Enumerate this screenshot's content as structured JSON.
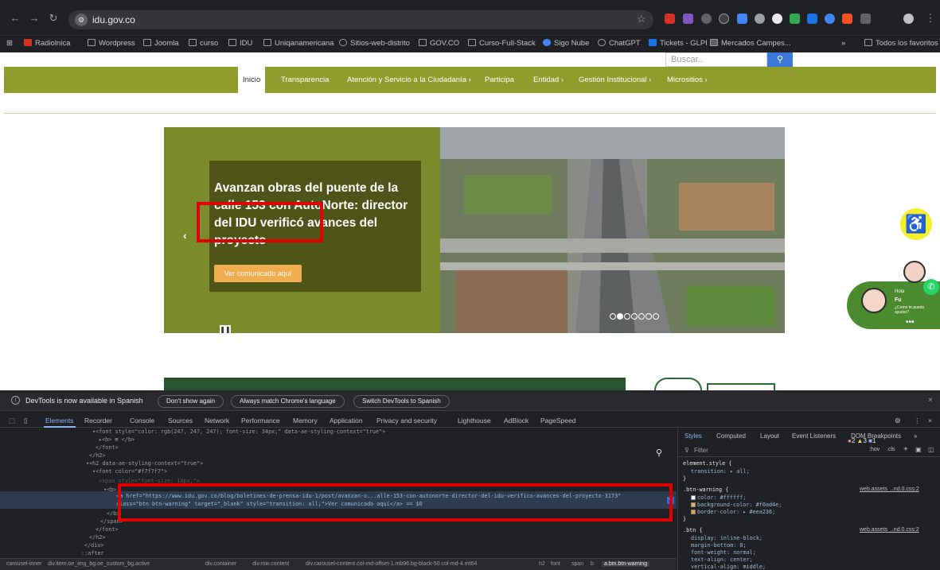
{
  "browser": {
    "url": "idu.gov.co",
    "bookmarks": [
      "Radiolnica",
      "Wordpress",
      "Joomla",
      "curso",
      "IDU",
      "Uniqanamericana",
      "Sitios-web-distrito",
      "GOV.CO",
      "Curso-Full-Stack",
      "Sigo Nube",
      "ChatGPT",
      "Tickets - GLPI",
      "Mercados Campes...",
      "Todos los favoritos"
    ],
    "bookmarks_more": "»"
  },
  "site": {
    "search_placeholder": "Buscar..",
    "search_button_icon": "search-icon",
    "nav": [
      "Inicio",
      "Transparencia",
      "Atención y Servicio a la Ciudadanía ›",
      "Participa",
      "Entidad ›",
      "Gestión Institucional ›",
      "Micrositios ›"
    ],
    "carousel": {
      "title": "Avanzan obras del puente de la calle 153 con AutoNorte: director del IDU verificó avances del proyecto",
      "button": "Ver comunicado aquí",
      "prev": "‹",
      "pause": "❚❚",
      "slide_count": 7,
      "active_slide": 2
    },
    "chat": {
      "greeting": "Hola",
      "name": "Fu",
      "question": "¿Como te puedo ayudar?",
      "dots": "•••"
    },
    "accessibility_icon": "accessibility-icon"
  },
  "devtools": {
    "notice": "DevTools is now available in Spanish",
    "notice_buttons": [
      "Don't show again",
      "Always match Chrome's language",
      "Switch DevTools to Spanish"
    ],
    "close": "×",
    "tabs": [
      "Elements",
      "Recorder",
      "Console",
      "Sources",
      "Network",
      "Performance",
      "Memory",
      "Application",
      "Privacy and security",
      "Lighthouse",
      "AdBlock",
      "PageSpeed"
    ],
    "issues": {
      "errors": "2",
      "warnings": "3",
      "info": "1"
    },
    "dom_lines": [
      "▾<font style=\"color: rgb(247, 247, 247); font-size: 34px;\" data-ae-styling-context=\"true\">",
      "▸<b> ⊞ </b>",
      "</font>",
      "</h2>",
      "▾<h2 data-ae-styling-context=\"true\">",
      "▾<font color=\"#f7f7f7\">",
      "<span style=\"font-size: 14px;\">",
      "▾<b>",
      "<a href=\"https://www.idu.gov.co/blog/boletines-de-prensa-idu-1/post/avanzan-o...alle-153-con-autonorte-director-del-idu-verifico-avances-del-proyecto-3173\"",
      "class=\"btn btn-warning\" target=\"_blank\" style=\"transition: all;\">Ver comunicado aquí</a> == $0",
      "</b>",
      "</span>",
      "</font>",
      "</h2>",
      "</div>",
      "::after"
    ],
    "breadcrumb": [
      "carousel-inner",
      "div.item.oe_img_bg.oe_custom_bg.active",
      "div.container",
      "div.row.content",
      "div.carousel-content.col-md-offset-1.mb96.bg-black-50.col-md-4.mt64",
      "h2",
      "font",
      "span",
      "b",
      "a.btn.btn-warning"
    ],
    "styles_tabs": [
      "Styles",
      "Computed",
      "Layout",
      "Event Listeners",
      "DOM Breakpoints",
      "»"
    ],
    "filter_placeholder": "Filter",
    "filter_tools": [
      ":hov",
      ".cls",
      "+"
    ],
    "rules": [
      {
        "selector": "element.style {",
        "props": [
          "transition: ▸ all;"
        ],
        "source": ""
      },
      {
        "selector": ".btn-warning {",
        "props": [
          "color: #ffffff;",
          "background-color: #f0ad4e;",
          "border-color: ▸ #eea236;"
        ],
        "source": "web.assets_..nd.0.css:2"
      },
      {
        "selector": ".btn {",
        "props": [
          "display: inline-block;",
          "margin-bottom: 0;",
          "font-weight: normal;",
          "text-align: center;",
          "vertical-align: middle;"
        ],
        "source": "web.assets_..nd.0.css:2"
      }
    ],
    "colors": {
      "white": "#ffffff",
      "warning": "#f0ad4e",
      "border": "#eea236"
    }
  }
}
